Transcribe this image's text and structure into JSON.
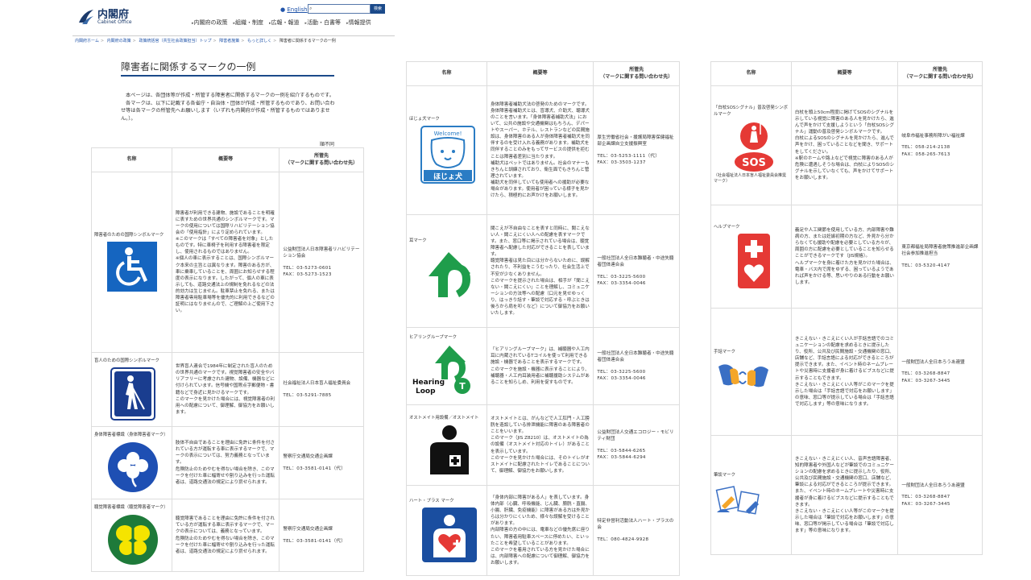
{
  "header": {
    "logo_jp": "内閣府",
    "logo_en": "Cabinet Office",
    "english_link": "English",
    "search_button": "検索",
    "nav": [
      "内閣府の政策",
      "組織・制度",
      "広報・報道",
      "活動・白書等",
      "情報提供"
    ]
  },
  "breadcrumb": [
    "内閣府ホーム",
    "内閣府の政策",
    "政策統括官（共生社会政策担当）トップ",
    "障害者施策",
    "もっと詳しく",
    "障害者に関係するマークの一例"
  ],
  "page": {
    "title": "障害者に関係するマークの一例",
    "intro1": "本ページは、各団体等が作成・所管する障害者に関係するマークの一例を紹介するものです。",
    "intro2": "各マークは、以下に記載する各省庁・自治体・団体が作成・所管するものであり、お問い合わせ等は各マークの所管先へお願いします（いずれも内閣府が作成・所管するものではありません。）。",
    "order_note": "順不同"
  },
  "table_headers": {
    "name": "名称",
    "desc": "概要等",
    "contact_line1": "所管先",
    "contact_line2": "（マークに関する問い合わせ先）"
  },
  "marks_left": [
    {
      "name": "障害者のための国際シンボルマーク",
      "desc": "障害者が利用できる建物、施設であることを明確に表すための世界共通のシンボルマークです。マークの使用については国際リハビリテーション協会の「使用指針」により定められています。\n※このマークは「すべての障害者を対象」としたものです。特に車椅子を利用する障害者を限定し、使用されるものではありません。\n※個人の車に表示することは、国際シンボルマーク本来の主旨とは異なります。障害のある方が、車に乗車していることを、周囲にお知らせする程度の表示になります。したがって、個人の車に表示しても、道路交通法上の規制を免れるなどの法的効力は生じません。駐車禁止を免れる、または障害者専用駐車場等を優先的に利用できるなどの証明にはなりませんので、ご理解の上ご使用下さい。",
      "org": "公益財団法人日本障害者リハビリテーション協会",
      "tel": "TEL：03-5273-0601",
      "fax": "FAX：03-5273-1523",
      "icon": "wheelchair-icon"
    },
    {
      "name": "盲人のための国際シンボルマーク",
      "desc": "世界盲人連合で1984年に制定された盲人のための世界共通のマークです。視覚障害者の安全やバリアフリーに考慮された建物、設備、機器などに付けられています。信号機や国際点字郵便物・書籍などで身近に見かけるマークです。\nこのマークを見かけた場合には、視覚障害者の利用への配慮について、御理解、御協力をお願いします。",
      "org": "社会福祉法人日本盲人福祉委員会",
      "tel": "TEL：03-5291-7885",
      "fax": "",
      "icon": "blind-person-icon"
    },
    {
      "name": "身体障害者標識（身体障害者マーク）",
      "desc": "肢体不自由であることを理由に免許に条件を付されている方が運転する車に表示するマークで、マークの表示については、努力義務となっています。\n危険防止のためやむを得ない場合を除き、このマークを付けた車に幅寄せや割り込みを行った運転者は、道路交通法の規定により罰せられます。",
      "org": "警察庁交通局交通企画課",
      "tel": "TEL：03-3581-0141（代）",
      "fax": "",
      "icon": "clover-icon"
    },
    {
      "name": "聴覚障害者標識（聴覚障害者マーク）",
      "desc": "聴覚障害であることを理由に免許に条件を付されている方が運転する車に表示するマークで、マークの表示については、義務となっています。\n危険防止のためやむを得ない場合を除き、このマークを付けた車に幅寄せや割り込みを行った運転者は、道路交通法の規定により罰せられます。",
      "org": "警察庁交通局交通企画課",
      "tel": "TEL：03-3581-0141（代）",
      "fax": "",
      "icon": "butterfly-icon"
    }
  ],
  "marks_middle": [
    {
      "name": "ほじょ犬マーク",
      "desc": "身体障害者補助犬法の啓発のためのマークです。\n身体障害者補助犬とは、盲導犬、介助犬、聴導犬のことを言います。「身体障害者補助犬法」において、公共の施設や交通機関はもちろん、デパートやスーパー、ホテル、レストランなどの民間施設は、身体障害のある人が身体障害者補助犬を同伴するのを受け入れる義務があります。補助犬を同伴することのみをもってサービスの提供を拒むことは障害者差別に当たります。\n補助犬はペットではありません。社会のマナーもきちんと訓練されており、衛生面でもきちんと管理されています。\n補助犬を同伴していても使用者への援助が必要な場合があります。使用者が困っている様子を見かけたら、積極的にお声かけをお願いします。",
      "org": "厚生労働省社会・援護局障害保健福祉部企画課自立支援振興室",
      "tel": "TEL：03-5253-1111（代）",
      "fax": "FAX：03-3503-1237",
      "icon": "dog-face-icon",
      "icon_label_top": "Welcome!",
      "icon_label_bottom": "ほじょ犬"
    },
    {
      "name": "耳マーク",
      "desc": "聞こえが不自由なことを表すと同時に、聞こえない人・聞こえにくい人への配慮を表すマークです。また、窓口等に掲示されている場合は、聴覚障害者へ配慮した対応ができることを表しています。\n聴覚障害者は見た目には分からないために、誤解されたり、不利益をこうむったり、社会生活上で不安が少なくありません。\nこのマークを提示された場合は、相手が「聞こえない・聞こえにくい」ことを理解し、コミュニケーションの方法等への配慮（口元を見せゆっくり、はっきり話す・筆談で対応する・呼ぶときは後ろから肩を叩くなど）について御協力をお願いいたします。",
      "org": "一般社団法人全日本難聴者・中途失聴者団体連合会",
      "tel": "TEL：03-3225-5600",
      "fax": "FAX：03-3354-0046",
      "icon": "ear-mark-icon"
    },
    {
      "name": "ヒアリングループマーク",
      "desc": "「ヒアリングループマーク」は、補聴器や人工内耳に内蔵されているTコイルを使って利用できる施設・機器であることを表示するマークです。\nこのマークを施設・機器に表示することにより、補聴器・人工内耳装用者に補聴援助システムがあることを知らしめ、利用を促すものです。",
      "org": "一般社団法人全日本難聴者・中途失聴者団体連合会",
      "tel": "TEL：03-3225-5600",
      "fax": "FAX：03-3354-0046",
      "icon": "hearing-loop-icon",
      "icon_label": "Hearing Loop"
    },
    {
      "name": "オストメイト用設備／オストメイト",
      "desc": "オストメイトとは、がんなどで人工肛門・人工膀胱を造設している排泄機能に障害のある障害者のことをいいます。\nこのマーク（JIS Z8210）は、オストメイトの為の設備（オストメイト対応のトイレ）があることを表示しています。\nこのマークを見かけた場合には、そのトイレがオストメイトに配慮されたトイレであることについて、御理解、御協力をお願いします。",
      "org": "公益財団法人交通エコロジー・モビリティ財団",
      "tel": "TEL：03-5844-6265",
      "fax": "FAX：03-5844-6294",
      "icon": "ostomate-icon"
    },
    {
      "name": "ハート・プラス マーク",
      "desc": "「身体内部に障害がある人」を表しています。身体内部（心臓、呼吸機能、じん臓、膀胱・直腸、小腸、肝臓、免疫機能）に障害がある方は外見からは分かりにくいため、様々な誤解を受けることがあります。\n内部障害の方の中には、電車などの優先席に座りたい、障害者用駐車スペースに停めたい、といったことを希望していることがあります。\nこのマークを着用されている方を見かけた場合には、内部障害への配慮について御理解、御協力をお願いします。",
      "org": "特定非営利活動法人ハート・プラスの会",
      "tel": "TEL：080-4824-9928",
      "fax": "",
      "icon": "heart-plus-icon"
    }
  ],
  "marks_right": [
    {
      "name": "「白杖SOSシグナル」普及啓発シンボルマーク",
      "sub": "（社会福祉法人日本盲人福祉委員会推奨マーク）",
      "desc": "白杖を頭上50cm程度に掲げてSOSのシグナルを示している視覚に障害のある人を見かけたら、進んで声をかけて支援しようという「白杖SOSシグナル」運動の普及啓発シンボルマークです。\n白杖によるSOSのシグナルを見かけたら、進んで声をかけ、困っていることなどを聞き、サポートをしてください。\n※駅のホームや路上などで視覚に障害のある人が危険に遭遇しそうな場合は、白杖によりSOSのシグナルを示していなくても、声をかけてサポートをお願いします。",
      "org": "岐阜市福祉事務所障がい福祉課",
      "tel": "TEL：058-214-2138",
      "fax": "FAX：058-265-7613",
      "icon": "white-cane-sos-icon",
      "icon_label": "SOS"
    },
    {
      "name": "ヘルプマーク",
      "desc": "義足や人工関節を使用している方、内部障害や難病の方、または妊娠初期の方など、外見から分からなくても援助や配慮を必要としている方々が、周囲の方に配慮を必要としていることを知らせることができるマークです（JIS規格）。\nヘルプマークを身に着けた方を見かけた場合は、電車・バス内で席をゆずる、困っているようであれば声をかける等、思いやりのある行動をお願いします。",
      "org": "東京都福祉局障害者施策推進部企画課社会参加推進担当",
      "tel": "TEL：03-5320-4147",
      "fax": "",
      "icon": "help-mark-icon"
    },
    {
      "name": "手話マーク",
      "desc": "きこえない・きこえにくい人が手話言語でのコミュニケーションの配慮を求めるときに提示したり、役所、公共及び民間施設・交通機関の窓口、店舗など、手話言語による対応ができるところが提示できます。また、イベント時のネームプレートや災害時に支援者が身に着けるビブスなどに提示することもできます。\nきこえない・きこえにくい人等がこのマークを提示した場合は「手話言語で対応をお願いします」の意味、窓口等が提示している場合は「手話言語で対応します」等の意味になります。",
      "org": "一般財団法人全日本ろうあ連盟",
      "tel": "TEL：03-3268-8847",
      "fax": "FAX：03-3267-3445",
      "icon": "sign-language-icon"
    },
    {
      "name": "筆談マーク",
      "desc": "きこえない・きこえにくい人、音声言語障害者、知的障害者や外国人などが筆談でのコミュニケーションの配慮を求めるときに提示したり、役所、公共及び民間施設・交通機関の窓口、店舗など、筆談による対応ができるところが提示できます。また、イベント時のネームプレートや災害時に支援者が身に着けるビブスなどに提示することもできます。\nきこえない・きこえにくい人等がこのマークを提示した場合は「筆談で対応をお願いします」の意味、窓口等が掲示している場合は「筆談で対応します」等の意味になります。",
      "org": "一般財団法人全日本ろうあ連盟",
      "tel": "TEL：03-3268-8847",
      "fax": "FAX：03-3267-3445",
      "icon": "writing-communication-icon"
    }
  ]
}
